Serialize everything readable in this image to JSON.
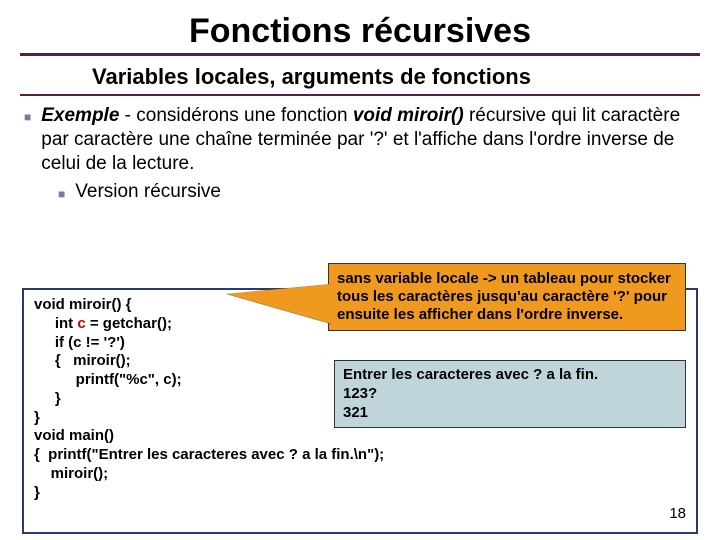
{
  "title": "Fonctions récursives",
  "subtitle": "Variables locales, arguments de fonctions",
  "bullet": {
    "lead": "Exemple",
    "dash": " - considérons une fonction ",
    "fn": "void miroir()",
    "rest": " récursive qui lit caractère par caractère une chaîne terminée par '?' et l'affiche dans l'ordre inverse de celui de la lecture."
  },
  "subbullet": "Version récursive",
  "code": {
    "l1": "void miroir() {",
    "l2": "     int ",
    "l2r": "c",
    "l2b": " = getchar();",
    "l3": "     if (c != '?')",
    "l4": "     {   miroir();",
    "l5": "          printf(\"%c\", c);",
    "l6": "     }",
    "l7": "}",
    "l8": "void main()",
    "l9": "{  printf(\"Entrer les caracteres avec ? a la fin.\\n\");",
    "l10": "    miroir();",
    "l11": "}"
  },
  "callout": "sans variable locale -> un tableau pour stocker tous les caractères jusqu'au caractère '?' pour ensuite les afficher dans l'ordre inverse.",
  "output": "Entrer les caracteres avec ? a la fin.\n123?\n321",
  "pagenum": "18"
}
